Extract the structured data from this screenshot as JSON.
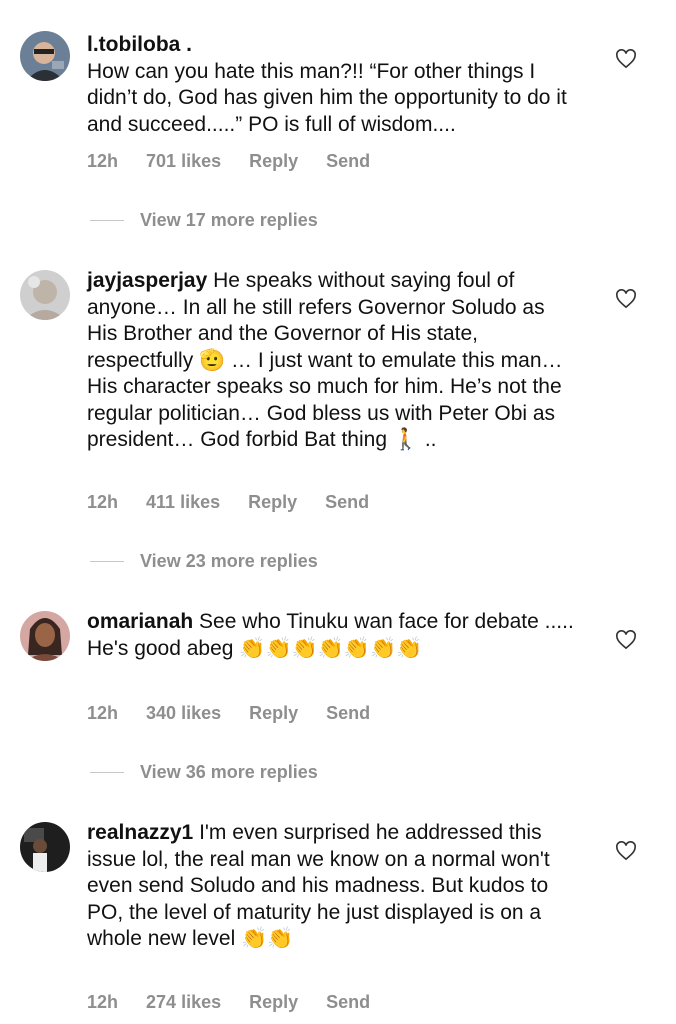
{
  "comments": [
    {
      "username": "l.tobiloba .",
      "text": "How can you hate this man?!! “For other things I didn’t do, God has given him the opportunity to do it and succeed.....” PO is full of wisdom....",
      "time": "12h",
      "likes": "701 likes",
      "reply": "Reply",
      "send": "Send",
      "view_replies": "View 17 more replies"
    },
    {
      "username": "jayjasperjay",
      "text": "He speaks without saying foul of anyone… In all he still refers Governor Soludo as His Brother and the Governor of His state, respectfully 🫡 … I just want to emulate this man… His character speaks so much for him. He’s not the regular politician… God bless us with Peter Obi as president… God forbid Bat thing 🚶 ..",
      "time": "12h",
      "likes": "411 likes",
      "reply": "Reply",
      "send": "Send",
      "view_replies": "View 23 more replies"
    },
    {
      "username": "omarianah",
      "text": "See who Tinuku wan face for debate ..... He's good abeg 👏👏👏👏👏👏👏",
      "time": "12h",
      "likes": "340 likes",
      "reply": "Reply",
      "send": "Send",
      "view_replies": "View 36 more replies"
    },
    {
      "username": "realnazzy1",
      "text": "I'm even surprised he addressed this issue lol, the real man we know on a normal won't even send Soludo and his madness. But kudos to PO, the level of maturity he just displayed is on a whole new level 👏👏",
      "time": "12h",
      "likes": "274 likes",
      "reply": "Reply",
      "send": "Send"
    }
  ]
}
